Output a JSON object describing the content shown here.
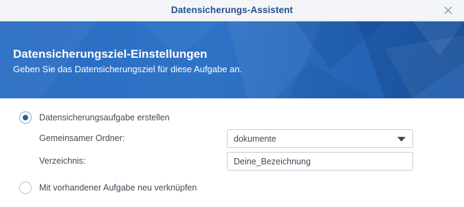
{
  "window": {
    "title": "Datensicherungs-Assistent",
    "close_icon": "close-icon"
  },
  "banner": {
    "title": "Datensicherungsziel-Einstellungen",
    "subtitle": "Geben Sie das Datensicherungsziel für diese Aufgabe an.",
    "colors": {
      "base": "#2a6ec3",
      "dark": "#1e5aa8"
    }
  },
  "options": {
    "create_task": {
      "label": "Datensicherungsaufgabe erstellen",
      "checked": true
    },
    "relink_task": {
      "label": "Mit vorhandener Aufgabe neu verknüpfen",
      "checked": false
    }
  },
  "fields": {
    "shared_folder": {
      "label": "Gemeinsamer Ordner:",
      "value": "dokumente",
      "icon": "dropdown-arrow-icon"
    },
    "directory": {
      "label": "Verzeichnis:",
      "value": "Deine_Bezeichnung"
    }
  },
  "colors": {
    "title_text": "#25508a",
    "radio_selected": "#2b5ba5",
    "text": "#414b55"
  }
}
